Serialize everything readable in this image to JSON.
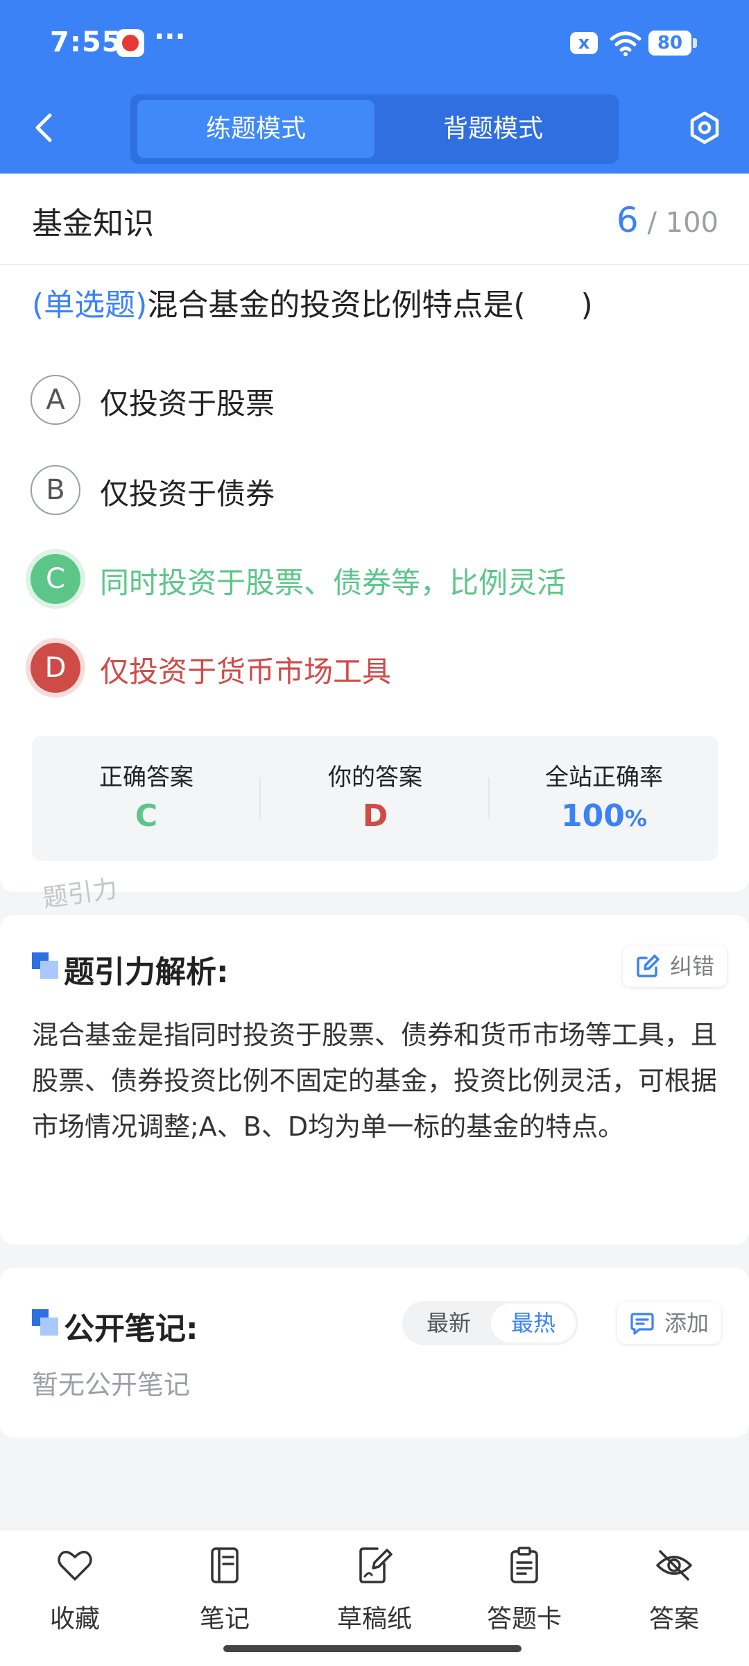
{
  "status_bar": {
    "time": "7:55",
    "dots": "···",
    "sim_icon": "x",
    "battery": "80"
  },
  "header": {
    "back_icon": "chevron-left-icon",
    "tabs": [
      {
        "label": "练题模式",
        "active": true
      },
      {
        "label": "背题模式",
        "active": false
      }
    ],
    "settings_icon": "hexagon-gear-icon"
  },
  "question": {
    "subject": "基金知识",
    "current": "6",
    "separator": "/",
    "total": "100",
    "type_label": "(单选题)",
    "text": "混合基金的投资比例特点是(",
    "close_paren": ")",
    "options": [
      {
        "letter": "A",
        "text": "仅投资于股票",
        "state": "normal"
      },
      {
        "letter": "B",
        "text": "仅投资于债券",
        "state": "normal"
      },
      {
        "letter": "C",
        "text": "同时投资于股票、债券等，比例灵活",
        "state": "correct"
      },
      {
        "letter": "D",
        "text": "仅投资于货币市场工具",
        "state": "wrong"
      }
    ]
  },
  "summary": {
    "correct_label": "正确答案",
    "correct_value": "C",
    "yours_label": "你的答案",
    "yours_value": "D",
    "rate_label": "全站正确率",
    "rate_value": "100",
    "rate_unit": "%"
  },
  "watermark": "题引力",
  "analysis": {
    "title": "题引力解析:",
    "report_label": "纠错",
    "text": "混合基金是指同时投资于股票、债券和货币市场等工具，且股票、债券投资比例不固定的基金，投资比例灵活，可根据市场情况调整;A、B、D均为单一标的基金的特点。"
  },
  "notes": {
    "title": "公开笔记:",
    "sort_latest": "最新",
    "sort_hot": "最热",
    "add_label": "添加",
    "empty": "暂无公开笔记"
  },
  "bottom_nav": [
    {
      "label": "收藏",
      "icon": "heart-icon"
    },
    {
      "label": "笔记",
      "icon": "notebook-icon"
    },
    {
      "label": "草稿纸",
      "icon": "draft-icon"
    },
    {
      "label": "答题卡",
      "icon": "answer-card-icon"
    },
    {
      "label": "答案",
      "icon": "eye-off-icon"
    }
  ],
  "colors": {
    "primary": "#3b82f6",
    "correct": "#5cc689",
    "wrong": "#cf4b48"
  }
}
